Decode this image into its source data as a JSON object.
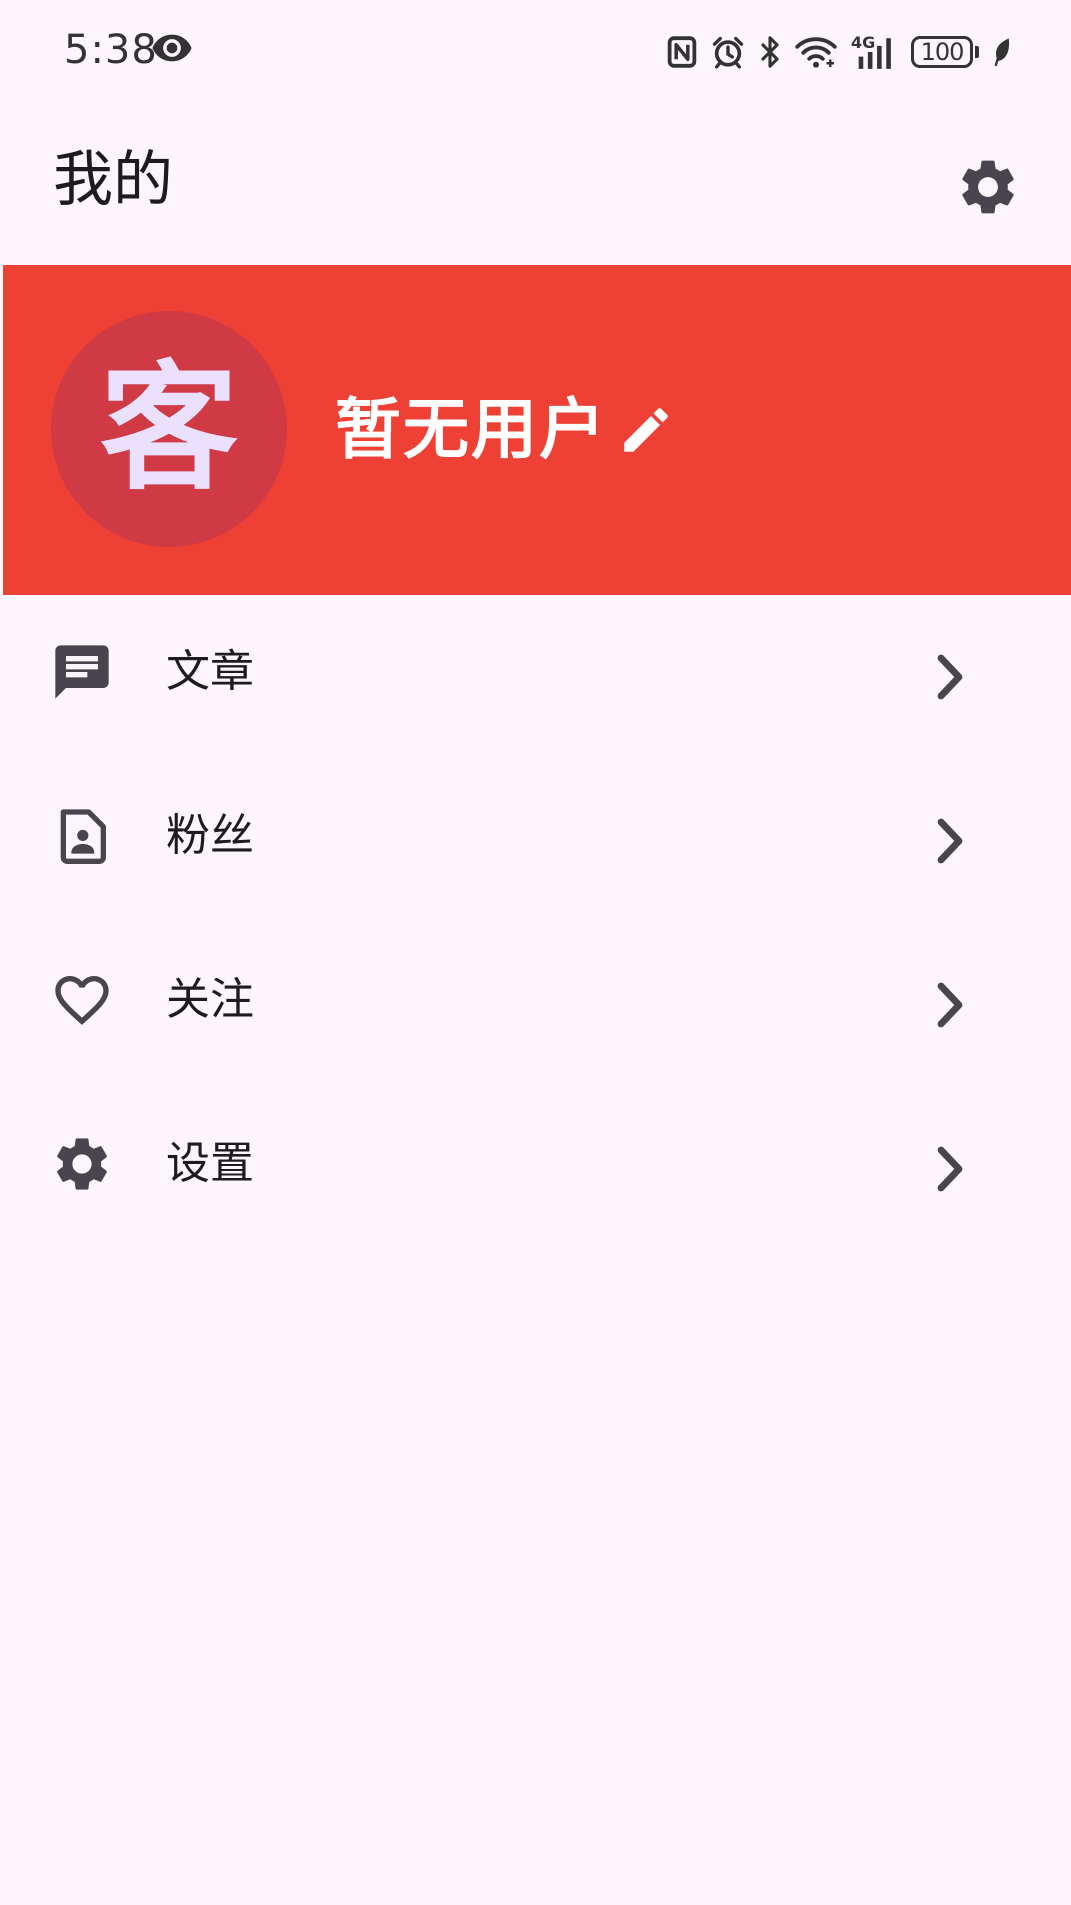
{
  "status_bar": {
    "time": "5:38",
    "network": "4G",
    "battery": "100"
  },
  "app_bar": {
    "title": "我的"
  },
  "profile": {
    "avatar_text": "客",
    "name": "暂无用户"
  },
  "menu": {
    "items": [
      {
        "label": "文章",
        "icon": "article-icon"
      },
      {
        "label": "粉丝",
        "icon": "contact-page-icon"
      },
      {
        "label": "关注",
        "icon": "heart-outline-icon"
      },
      {
        "label": "设置",
        "icon": "gear-icon"
      }
    ]
  },
  "colors": {
    "background": "#fcf5fd",
    "banner": "#ee4035",
    "avatar": "#cf3a45",
    "avatar_text": "#ece0ff",
    "icon": "#49454f"
  }
}
